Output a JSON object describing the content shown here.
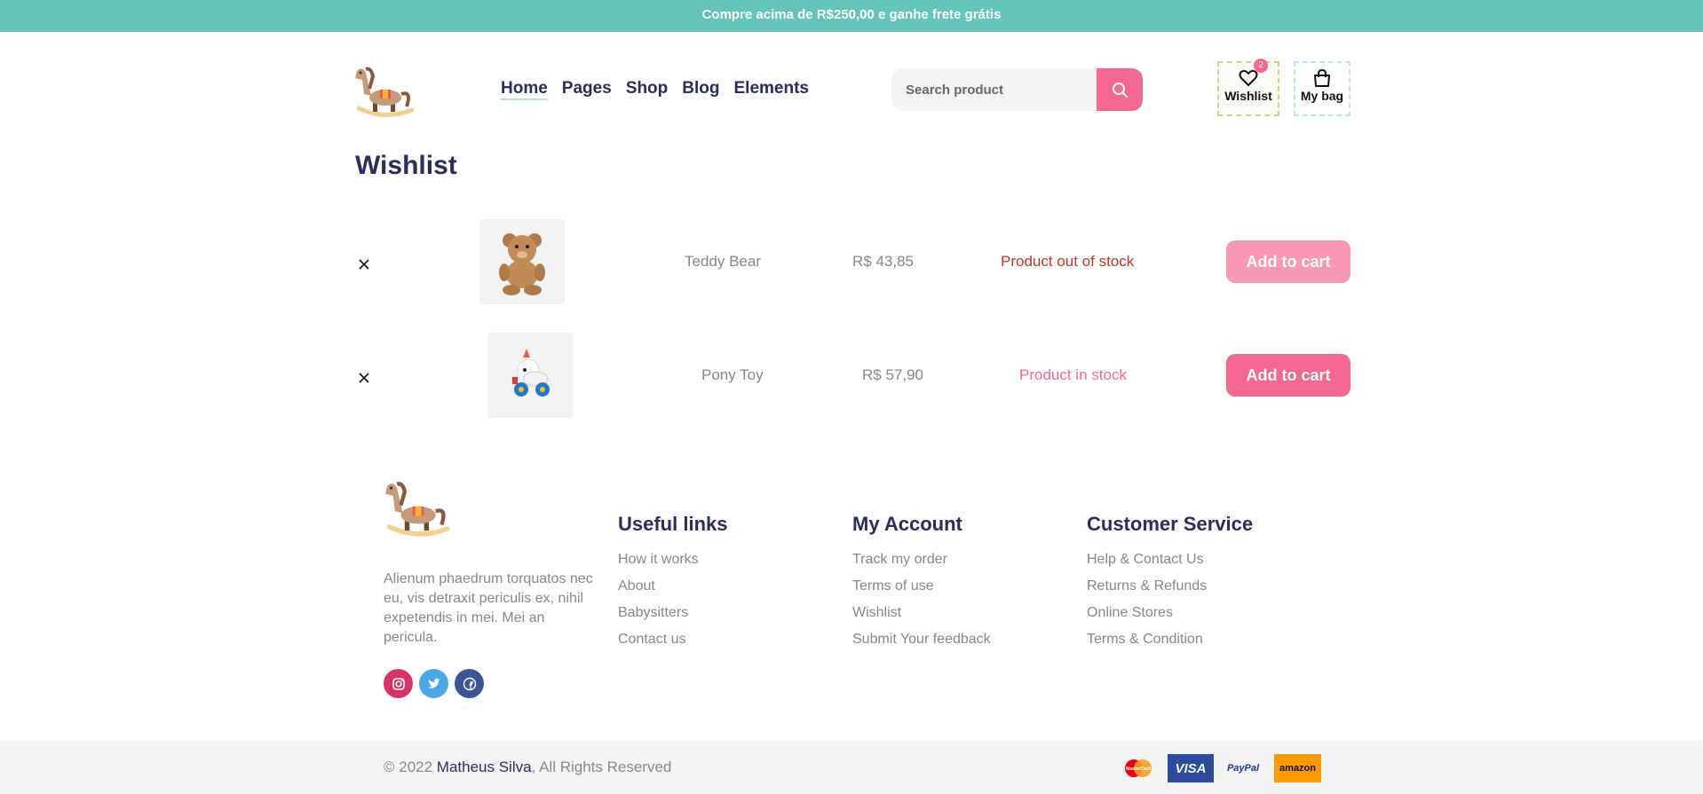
{
  "announcement": "Compre acima de R$250,00 e ganhe frete grátis",
  "header": {
    "nav": [
      "Home",
      "Pages",
      "Shop",
      "Blog",
      "Elements"
    ],
    "search_placeholder": "Search product",
    "wishlist_label": "Wishlist",
    "wishlist_count": "2",
    "bag_label": "My bag"
  },
  "page_title": "Wishlist",
  "wishlist": [
    {
      "name": "Teddy Bear",
      "price": "R$ 43,85",
      "stock": "Product out of stock",
      "stock_color": "#c0392b",
      "button": "Add to cart",
      "button_color": "#f898b4"
    },
    {
      "name": "Pony Toy",
      "price": "R$ 57,90",
      "stock": "Product in stock",
      "stock_color": "#f56891",
      "button": "Add to cart",
      "button_color": "#f56891"
    }
  ],
  "footer": {
    "description": "Alienum phaedrum torquatos nec eu, vis detraxit periculis ex, nihil expetendis in mei. Mei an pericula.",
    "columns": [
      {
        "title": "Useful links",
        "links": [
          "How it works",
          "About",
          "Babysitters",
          "Contact us"
        ]
      },
      {
        "title": "My Account",
        "links": [
          "Track my order",
          "Terms of use",
          "Wishlist",
          "Submit Your feedback"
        ]
      },
      {
        "title": "Customer Service",
        "links": [
          "Help & Contact Us",
          "Returns & Refunds",
          "Online Stores",
          "Terms & Condition"
        ]
      }
    ],
    "social": [
      "instagram-icon",
      "twitter-icon",
      "facebook-icon"
    ],
    "copyright_prefix": "© 2022 ",
    "copyright_author": "Matheus Silva",
    "copyright_suffix": ", All Rights Reserved",
    "payments": {
      "mastercard": "MasterCard",
      "visa": "VISA",
      "paypal": "PayPal",
      "amazon": "amazon"
    }
  },
  "colors": {
    "teal": "#64c4b9",
    "pink": "#f56891",
    "navy": "#2b2d5a"
  }
}
